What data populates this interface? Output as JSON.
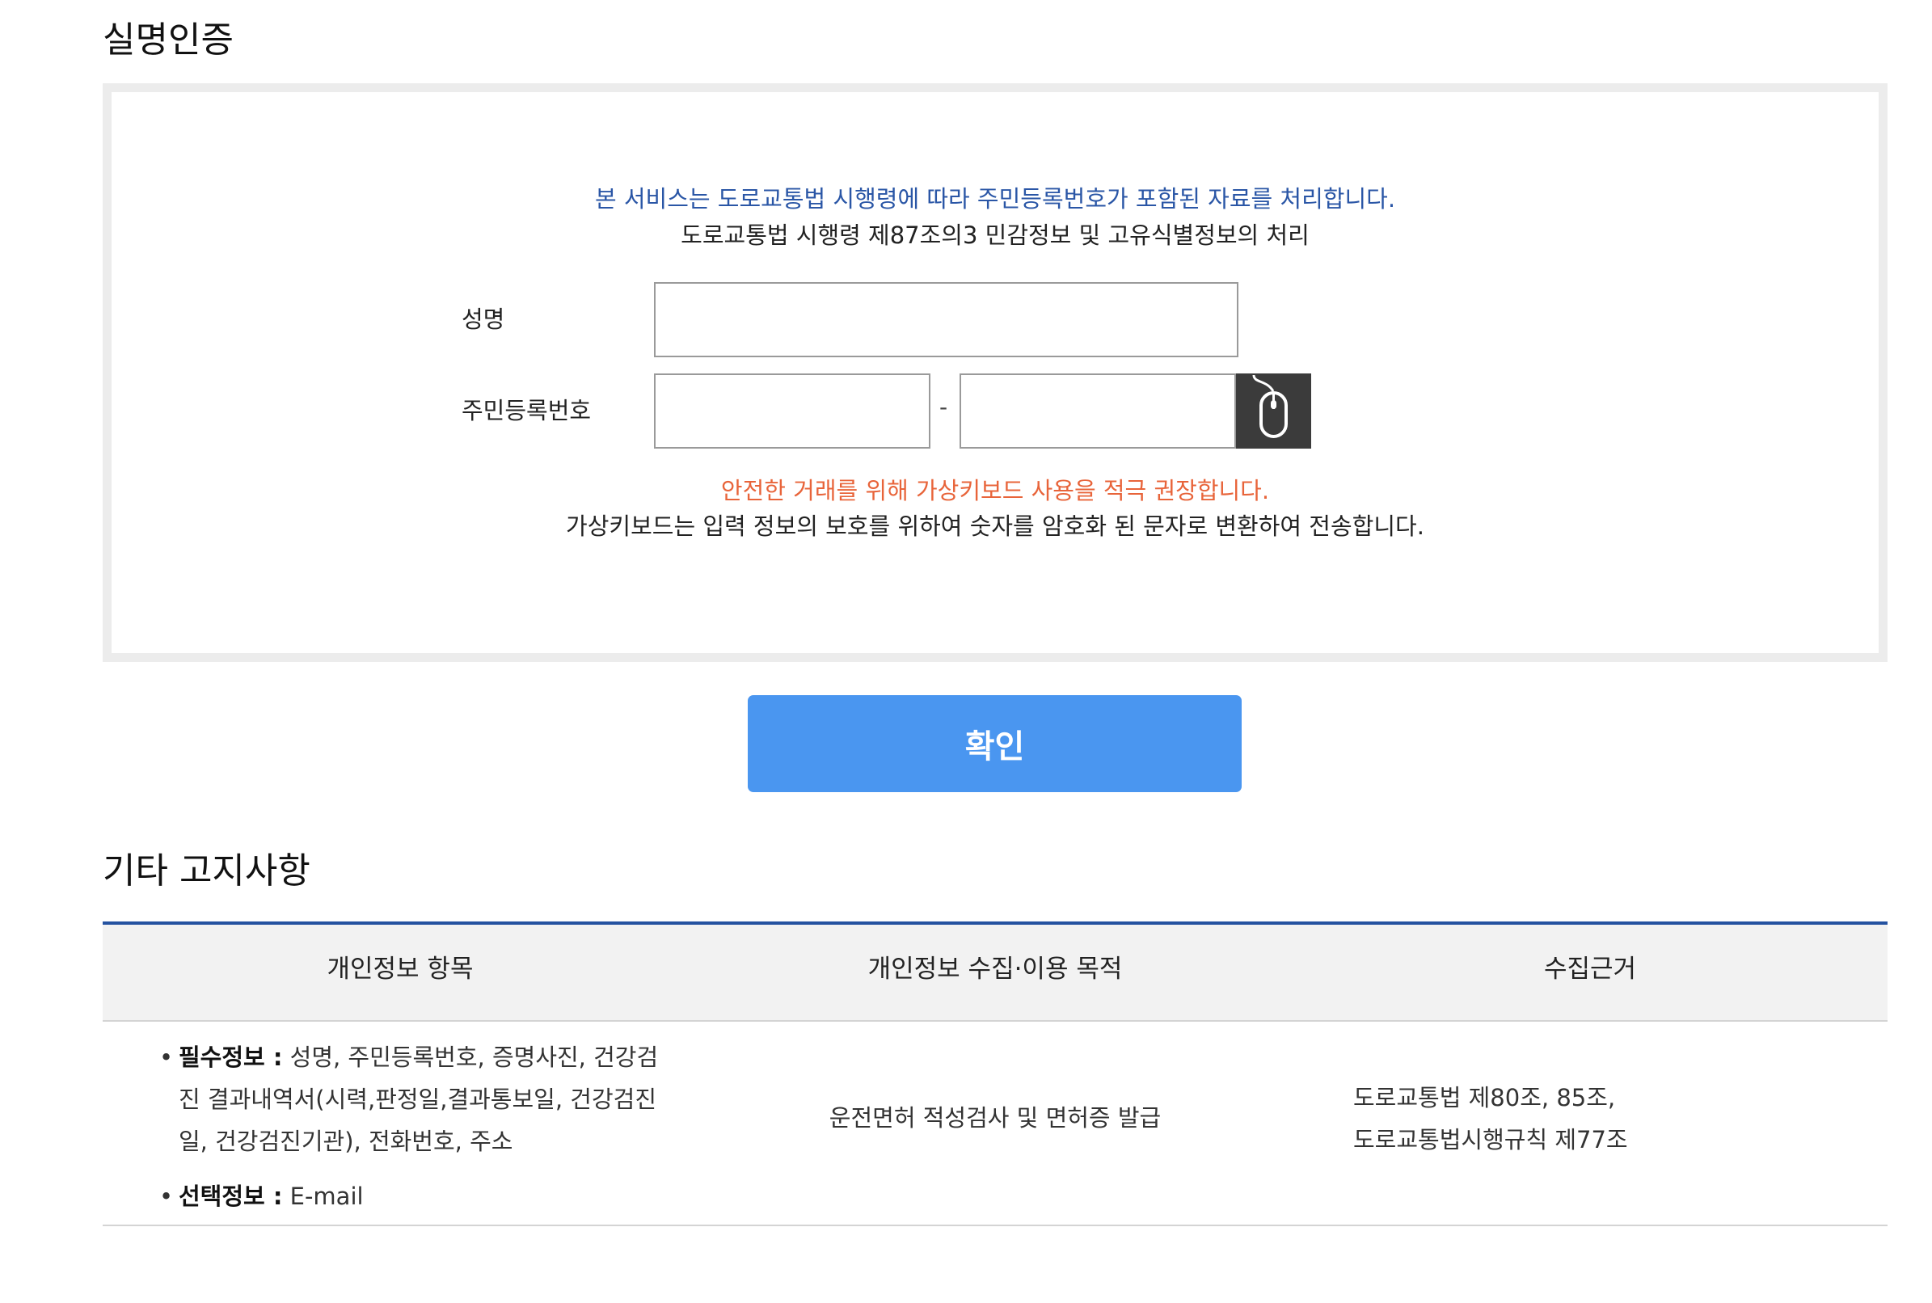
{
  "auth": {
    "title": "실명인증",
    "notice_blue": "본 서비스는 도로교통법 시행령에 따라 주민등록번호가 포함된 자료를 처리합니다.",
    "notice_law": "도로교통법 시행령 제87조의3 민감정보 및 고유식별정보의 처리",
    "name_label": "성명",
    "name_value": "",
    "rrn_label": "주민등록번호",
    "rrn_first_value": "",
    "rrn_second_value": "",
    "rrn_separator": "-",
    "virtual_keyboard_icon": "mouse-icon",
    "notice_orange": "안전한 거래를 위해 가상키보드 사용을 적극 권장합니다.",
    "notice_keyboard": "가상키보드는 입력 정보의 보호를 위하여 숫자를 암호화 된 문자로 변환하여 전송합니다."
  },
  "confirm_button": "확인",
  "other_notice": {
    "title": "기타 고지사항",
    "headers": [
      "개인정보 항목",
      "개인정보 수집·이용 목적",
      "수집근거"
    ],
    "required_label": "필수정보 :",
    "required_value": "성명, 주민등록번호, 증명사진, 건강검진 결과내역서(시력,판정일,결과통보일, 건강검진일, 건강검진기관), 전화번호, 주소",
    "optional_label": "선택정보 :",
    "optional_value": "E-mail",
    "purpose": "운전면허 적성검사 및 면허증 발급",
    "basis_line1": "도로교통법 제80조, 85조,",
    "basis_line2": "도로교통법시행규칙 제77조"
  },
  "colors": {
    "blue_notice": "#2a56a6",
    "orange_notice": "#e8643a",
    "confirm_button": "#4a96f0",
    "table_top_border": "#2452a0",
    "table_header_bg": "#f2f2f2",
    "box_border": "#ececec",
    "keyboard_button_bg": "#3b3b3b"
  }
}
